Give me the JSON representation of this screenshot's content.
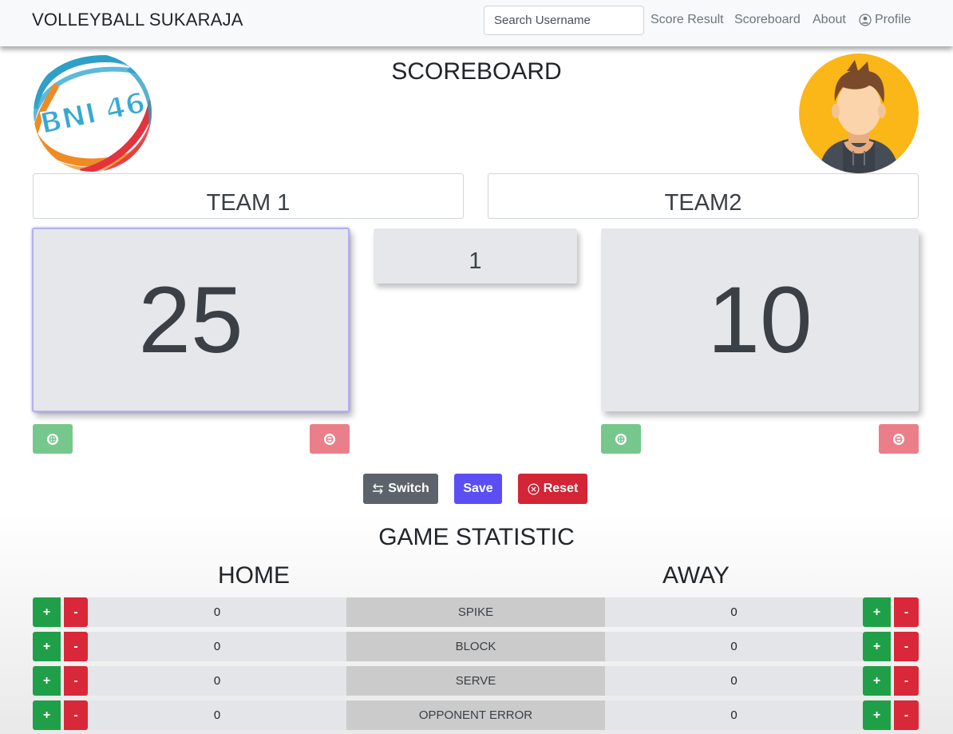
{
  "navbar": {
    "brand": "VOLLEYBALL SUKARAJA",
    "search_placeholder": "Search Username",
    "links": {
      "score_result": "Score Result",
      "scoreboard": "Scoreboard",
      "about": "About",
      "profile": "Profile"
    }
  },
  "header": {
    "logo_text": "BNI 46",
    "title": "SCOREBOARD"
  },
  "teams": {
    "home_name": "TEAM 1",
    "away_name": "TEAM2"
  },
  "scores": {
    "home": "25",
    "away": "10",
    "set": "1"
  },
  "controls": {
    "plus_icon": "⊕",
    "minus_icon": "⊖",
    "switch_label": "Switch",
    "save_label": "Save",
    "reset_label": "Reset"
  },
  "statistics": {
    "title": "GAME STATISTIC",
    "home_label": "HOME",
    "away_label": "AWAY",
    "plus": "+",
    "minus": "-",
    "rows": [
      {
        "name": "SPIKE",
        "home": "0",
        "away": "0"
      },
      {
        "name": "BLOCK",
        "home": "0",
        "away": "0"
      },
      {
        "name": "SERVE",
        "home": "0",
        "away": "0"
      },
      {
        "name": "OPPONENT ERROR",
        "home": "0",
        "away": "0"
      }
    ]
  },
  "colors": {
    "success": "#198754",
    "danger": "#dc3545",
    "save": "#5b4ff3",
    "secondary": "#6c757d"
  }
}
